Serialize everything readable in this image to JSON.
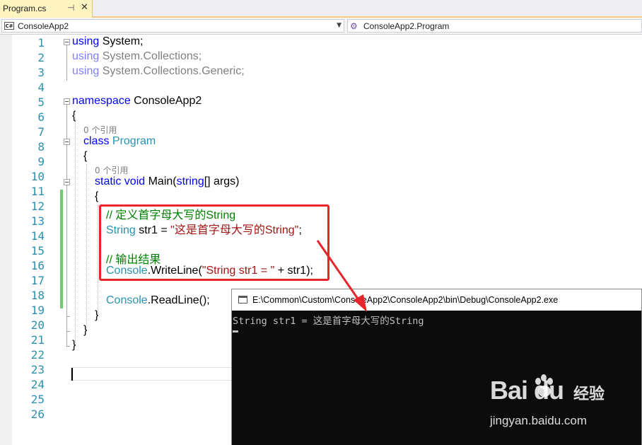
{
  "tab": {
    "filename": "Program.cs",
    "pin": "⊣",
    "close": "✕"
  },
  "nav": {
    "project_icon": "C#",
    "project": "ConsoleApp2",
    "class_icon": "class-icon",
    "class_path": "ConsoleApp2.Program"
  },
  "editor": {
    "line_numbers": [
      "1",
      "2",
      "3",
      "4",
      "5",
      "6",
      "7",
      "8",
      "9",
      "10",
      "11",
      "12",
      "13",
      "14",
      "15",
      "16",
      "17",
      "18",
      "19",
      "20",
      "21",
      "22",
      "23",
      "24",
      "25",
      "26"
    ],
    "code": {
      "l1_kw": "using",
      "l1_rest": " System;",
      "l2_kw": "using",
      "l2_rest": " System.Collections;",
      "l3_kw": "using",
      "l3_rest": " System.Collections.Generic;",
      "l5_kw": "namespace",
      "l5_rest": " ConsoleApp2",
      "l6": "{",
      "ref_class": "0 个引用",
      "l7_kw": "class",
      "l7_type": " Program",
      "l8": "{",
      "ref_main": "0 个引用",
      "l9_kw1": "static",
      "l9_kw2": " void",
      "l9_a": " Main(",
      "l9_kw3": "string",
      "l9_b": "[] args)",
      "l10": "{",
      "l11_cmt": "// 定义首字母大写的String",
      "l12_type": "String",
      "l12_a": " str1 = ",
      "l12_str": "\"这是首字母大写的String\"",
      "l12_b": ";",
      "l14_cmt": "// 输出结果",
      "l15_type": "Console",
      "l15_a": ".WriteLine(",
      "l15_str": "\"String str1 = \"",
      "l15_b": " + str1);",
      "l17_type": "Console",
      "l17_a": ".ReadLine();",
      "l18": "}",
      "l19": "}",
      "l20": "}"
    }
  },
  "console": {
    "title": "E:\\Common\\Custom\\ConsoleApp2\\ConsoleApp2\\bin\\Debug\\ConsoleApp2.exe",
    "output": "String str1 = 这是首字母大写的String"
  },
  "watermark": {
    "logo": "Bai du",
    "cn": "经验",
    "url": "jingyan.baidu.com"
  },
  "colors": {
    "keyword": "#0000ff",
    "type": "#2b91af",
    "string": "#a31515",
    "comment": "#008000",
    "highlight_box": "#e8252a",
    "change_bar": "#6fcf6f"
  }
}
